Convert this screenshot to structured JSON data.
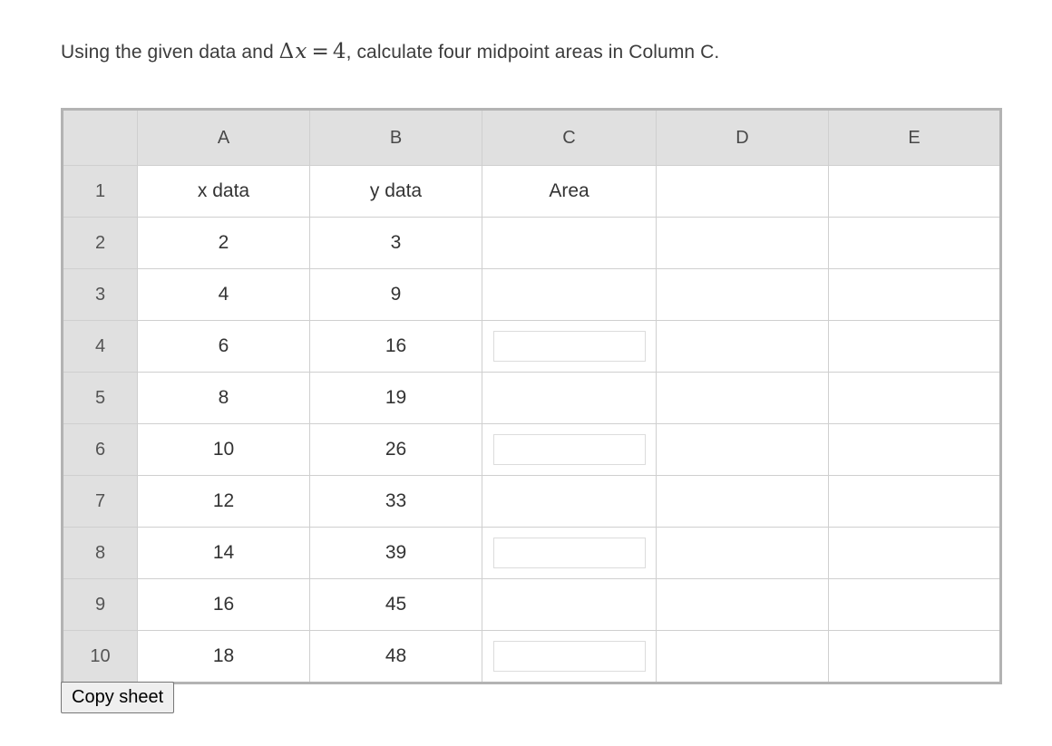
{
  "prompt": {
    "before_math": "Using the given data and",
    "math": {
      "delta": "Δ",
      "variable": "x",
      "equals": "=",
      "value": "4"
    },
    "after_math": ", calculate four midpoint areas in Column C."
  },
  "spreadsheet": {
    "column_headers": [
      "A",
      "B",
      "C",
      "D",
      "E"
    ],
    "row_headers": [
      "1",
      "2",
      "3",
      "4",
      "5",
      "6",
      "7",
      "8",
      "9",
      "10"
    ],
    "rows": [
      {
        "row": "1",
        "A": "x data",
        "B": "y data",
        "C": "Area",
        "D": "",
        "E": "",
        "c_input": false
      },
      {
        "row": "2",
        "A": "2",
        "B": "3",
        "C": "",
        "D": "",
        "E": "",
        "c_input": false
      },
      {
        "row": "3",
        "A": "4",
        "B": "9",
        "C": "",
        "D": "",
        "E": "",
        "c_input": false
      },
      {
        "row": "4",
        "A": "6",
        "B": "16",
        "C": "",
        "D": "",
        "E": "",
        "c_input": true,
        "c_value": ""
      },
      {
        "row": "5",
        "A": "8",
        "B": "19",
        "C": "",
        "D": "",
        "E": "",
        "c_input": false
      },
      {
        "row": "6",
        "A": "10",
        "B": "26",
        "C": "",
        "D": "",
        "E": "",
        "c_input": true,
        "c_value": ""
      },
      {
        "row": "7",
        "A": "12",
        "B": "33",
        "C": "",
        "D": "",
        "E": "",
        "c_input": false
      },
      {
        "row": "8",
        "A": "14",
        "B": "39",
        "C": "",
        "D": "",
        "E": "",
        "c_input": true,
        "c_value": ""
      },
      {
        "row": "9",
        "A": "16",
        "B": "45",
        "C": "",
        "D": "",
        "E": "",
        "c_input": false
      },
      {
        "row": "10",
        "A": "18",
        "B": "48",
        "C": "",
        "D": "",
        "E": "",
        "c_input": true,
        "c_value": ""
      }
    ]
  },
  "buttons": {
    "copy_sheet": "Copy sheet"
  },
  "colors": {
    "header_bg": "#e0e0e0",
    "grid_line": "#cfcfcf",
    "outer_border": "#b3b3b3",
    "text": "#333333",
    "header_text": "#494949",
    "button_bg": "#efefef",
    "button_border": "#767676",
    "input_border": "#dcdcdc"
  }
}
